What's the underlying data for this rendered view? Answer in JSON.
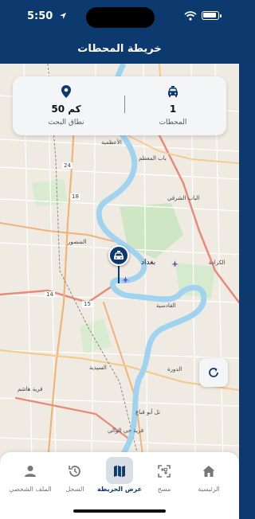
{
  "status_bar": {
    "time": "5:50"
  },
  "header": {
    "title": "خريطة المحطات"
  },
  "stats": {
    "stations": {
      "value": "1",
      "label": "المحطات",
      "icon": "taxi-icon"
    },
    "range": {
      "value": "50 كم",
      "label": "نطاق البحث",
      "icon": "location-pin-icon"
    }
  },
  "map": {
    "labels": {
      "a3": "الأعظمية",
      "bab_muadham": "باب المعظم",
      "bab_sharqi": "الباب الشرقي",
      "mansour": "المنصور",
      "baghdad": "بغداد",
      "karrada": "الكرادة",
      "qadisiya": "القادسية",
      "sayidiya": "السيدية",
      "dora": "الدورة",
      "tal": "تل أبو قباع",
      "hayy": "قرية حي الوالي",
      "qarya": "قرية هاشم",
      "rd24": "24",
      "rd18": "18",
      "rd14": "14",
      "rd15": "15"
    },
    "marker": {
      "icon": "taxi-icon"
    }
  },
  "refresh": {
    "icon": "refresh-icon"
  },
  "tabs": [
    {
      "id": "profile",
      "label": "الملف الشخصي",
      "icon": "person-icon"
    },
    {
      "id": "history",
      "label": "السجل",
      "icon": "history-icon"
    },
    {
      "id": "map",
      "label": "عرض الخريطة",
      "icon": "map-icon",
      "active": true
    },
    {
      "id": "scan",
      "label": "مسح",
      "icon": "scan-icon"
    },
    {
      "id": "home",
      "label": "الرئيسية",
      "icon": "home-icon"
    }
  ]
}
